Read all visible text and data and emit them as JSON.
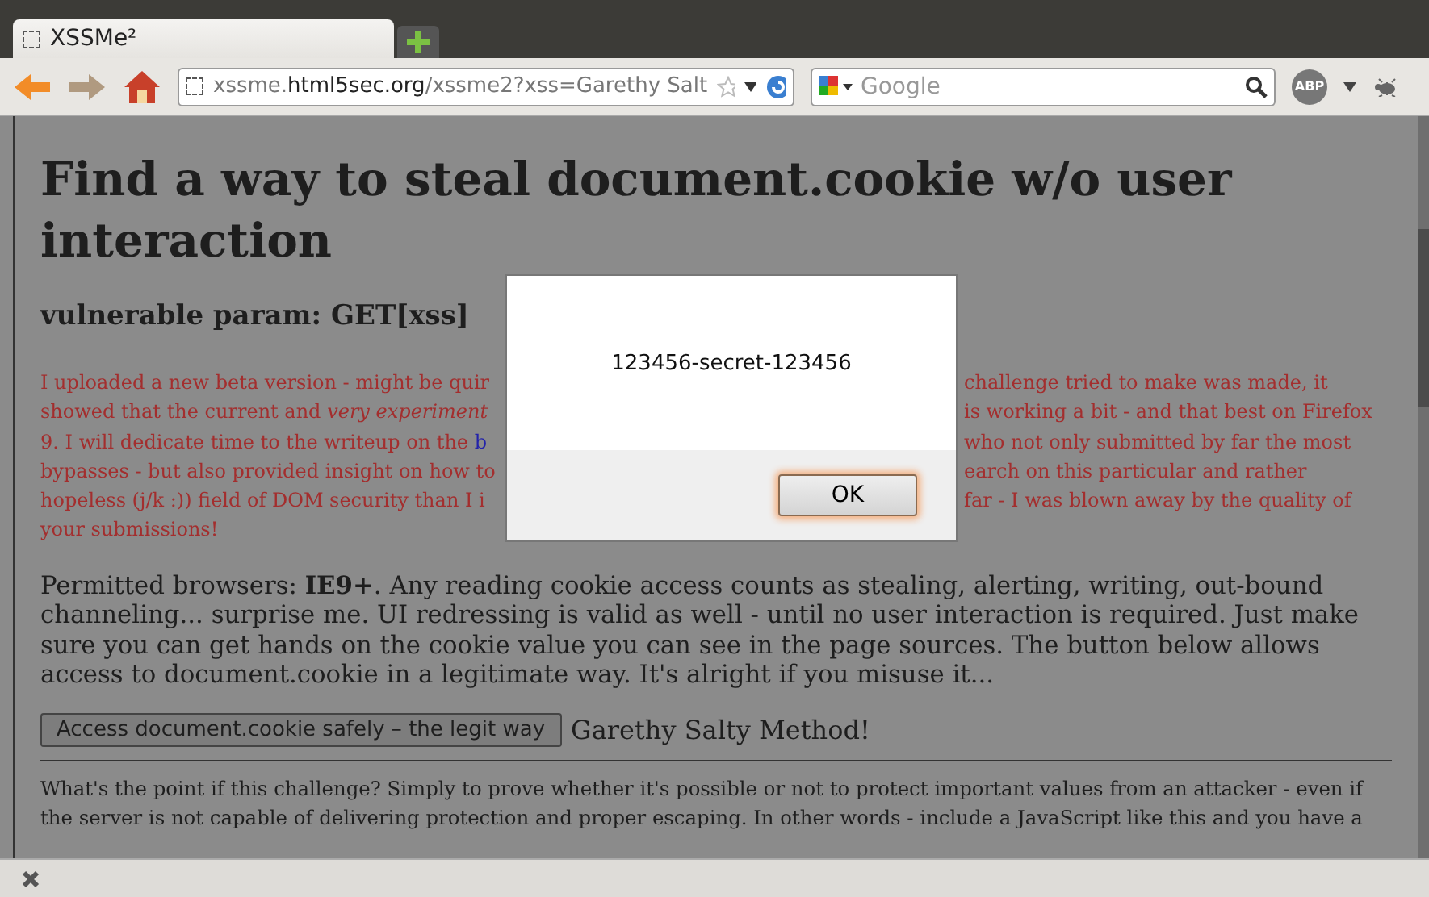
{
  "browser": {
    "tab": {
      "title": "XSSMe²"
    },
    "url": {
      "host_prefix": "xssme.",
      "domain": "html5sec.org",
      "path": "/xssme2?xss=Garethy Salt"
    },
    "search": {
      "placeholder": "Google"
    },
    "addon_badge": "ABP"
  },
  "page": {
    "heading": "Find a way to steal document.cookie w/o user interaction",
    "subheading": "vulnerable param: GET[xss]",
    "notice_lines": [
      {
        "left": "I uploaded a new beta version - might be quir",
        "right": "challenge tried to make was made, it"
      },
      {
        "left": "showed that the current and *very experiment*",
        "right": "is working a bit - and that best on Firefox"
      },
      {
        "left": "9. I will dedicate time to the writeup on the ",
        "link": "b",
        "right": "who not only submitted by far the most"
      },
      {
        "left": "bypasses - but also provided insight on how to",
        "right": "earch on this particular and rather"
      },
      {
        "left": "hopeless (j/k :)) field of DOM security than I i",
        "right": "far - I was blown away by the quality of"
      },
      {
        "left": "your submissions!"
      }
    ],
    "permitted": "Permitted browsers: **IE9+**. Any reading cookie access counts as stealing, alerting, writing, out-bound channeling... surprise me. UI redressing is valid as well - until no user interaction is required. Just make sure you can get hands on the cookie value you can see in the page sources. The button below allows access to document.cookie in a legitimate way. It's alright if you misuse it...",
    "access_button": "Access document.cookie safely – the legit way",
    "method": "Garethy Salty Method!",
    "explanation": "What's the point if this challenge? Simply to prove whether it's possible or not to protect important values from an attacker - even if the server is not capable of delivering protection and proper escaping. In other words - include a JavaScript like this and you have a"
  },
  "dialog": {
    "message": "123456-secret-123456",
    "button": "OK"
  }
}
